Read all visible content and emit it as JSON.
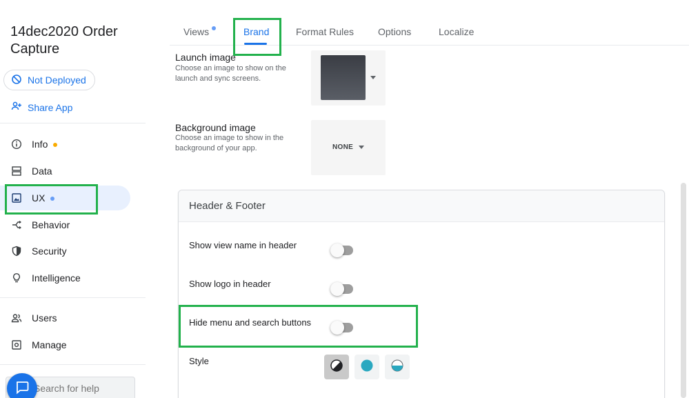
{
  "app": {
    "title": "14dec2020 Order Capture",
    "deploy_status": "Not Deployed",
    "share_label": "Share App"
  },
  "sidebar": {
    "items": [
      {
        "label": "Info",
        "icon": "info-icon",
        "indicator": "#f9ab00"
      },
      {
        "label": "Data",
        "icon": "data-icon"
      },
      {
        "label": "UX",
        "icon": "ux-icon",
        "indicator": "#669df6",
        "active": true
      },
      {
        "label": "Behavior",
        "icon": "behavior-icon"
      },
      {
        "label": "Security",
        "icon": "shield-icon"
      },
      {
        "label": "Intelligence",
        "icon": "lightbulb-icon"
      },
      {
        "label": "Users",
        "icon": "users-icon"
      },
      {
        "label": "Manage",
        "icon": "manage-icon"
      }
    ],
    "search_placeholder": "Search for help"
  },
  "tabs": [
    {
      "label": "Views",
      "badge": true
    },
    {
      "label": "Brand",
      "active": true
    },
    {
      "label": "Format Rules"
    },
    {
      "label": "Options"
    },
    {
      "label": "Localize"
    }
  ],
  "brand": {
    "launch_image": {
      "title": "Launch image",
      "description": "Choose an image to show on the launch and sync screens."
    },
    "background_image": {
      "title": "Background image",
      "description": "Choose an image to show in the background of your app.",
      "value": "NONE"
    }
  },
  "header_footer": {
    "title": "Header & Footer",
    "options": [
      {
        "label": "Show view name in header",
        "enabled": false
      },
      {
        "label": "Show logo in header",
        "enabled": false
      },
      {
        "label": "Hide menu and search buttons",
        "enabled": false
      }
    ],
    "style_label": "Style",
    "style_options": [
      "contrast-icon",
      "filled-circle-icon",
      "half-circle-icon"
    ]
  },
  "colors": {
    "accent": "#1a73e8",
    "highlight": "#22b14c",
    "teal": "#2aa8c0"
  }
}
